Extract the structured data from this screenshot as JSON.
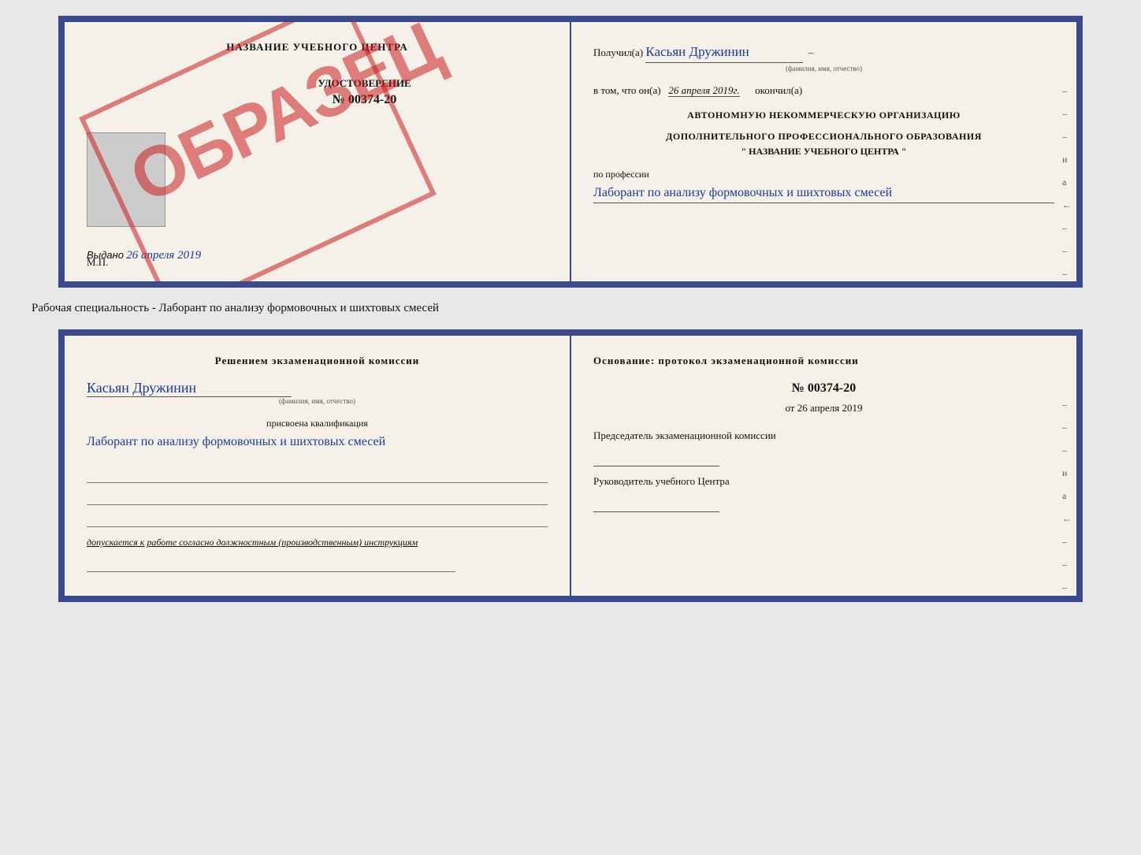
{
  "upper_card": {
    "left": {
      "title": "НАЗВАНИЕ УЧЕБНОГО ЦЕНТРА",
      "cert_label": "УДОСТОВЕРЕНИЕ",
      "cert_number": "№ 00374-20",
      "issued_label": "Выдано",
      "issued_date": "26 апреля 2019",
      "mp_label": "М.П.",
      "stamp_text": "ОБРАЗЕЦ"
    },
    "right": {
      "received_label": "Получил(а)",
      "received_name": "Касьян Дружинин",
      "name_subtext": "(фамилия, имя, отчество)",
      "completed_prefix": "в том, что он(а)",
      "completed_date": "26 апреля 2019г.",
      "completed_suffix": "окончил(а)",
      "org_line1": "АВТОНОМНУЮ НЕКОММЕРЧЕСКУЮ ОРГАНИЗАЦИЮ",
      "org_line2": "ДОПОЛНИТЕЛЬНОГО ПРОФЕССИОНАЛЬНОГО ОБРАЗОВАНИЯ",
      "org_name": "\"  НАЗВАНИЕ УЧЕБНОГО ЦЕНТРА  \"",
      "profession_label": "по профессии",
      "profession_value": "Лаборант по анализу формовочных и шихтовых смесей",
      "side_dashes": [
        "–",
        "–",
        "–",
        "и",
        "а",
        "←",
        "–",
        "–",
        "–"
      ]
    }
  },
  "specialty_text": "Рабочая специальность - Лаборант по анализу формовочных и шихтовых смесей",
  "lower_card": {
    "left": {
      "intro": "Решением экзаменационной комиссии",
      "name": "Касьян Дружинин",
      "name_subtext": "(фамилия, имя, отчество)",
      "qualification_label": "присвоена квалификация",
      "qualification_value": "Лаборант по анализу формовочных и шихтовых смесей",
      "admission_label": "допускается к",
      "admission_value": "работе согласно должностным (производственным) инструкциям"
    },
    "right": {
      "basis_label": "Основание: протокол экзаменационной комиссии",
      "doc_number": "№ 00374-20",
      "date_prefix": "от",
      "date_value": "26 апреля 2019",
      "chairman_label": "Председатель экзаменационной комиссии",
      "head_label": "Руководитель учебного Центра",
      "side_dashes": [
        "–",
        "–",
        "–",
        "и",
        "а",
        "←",
        "–",
        "–",
        "–"
      ]
    }
  }
}
